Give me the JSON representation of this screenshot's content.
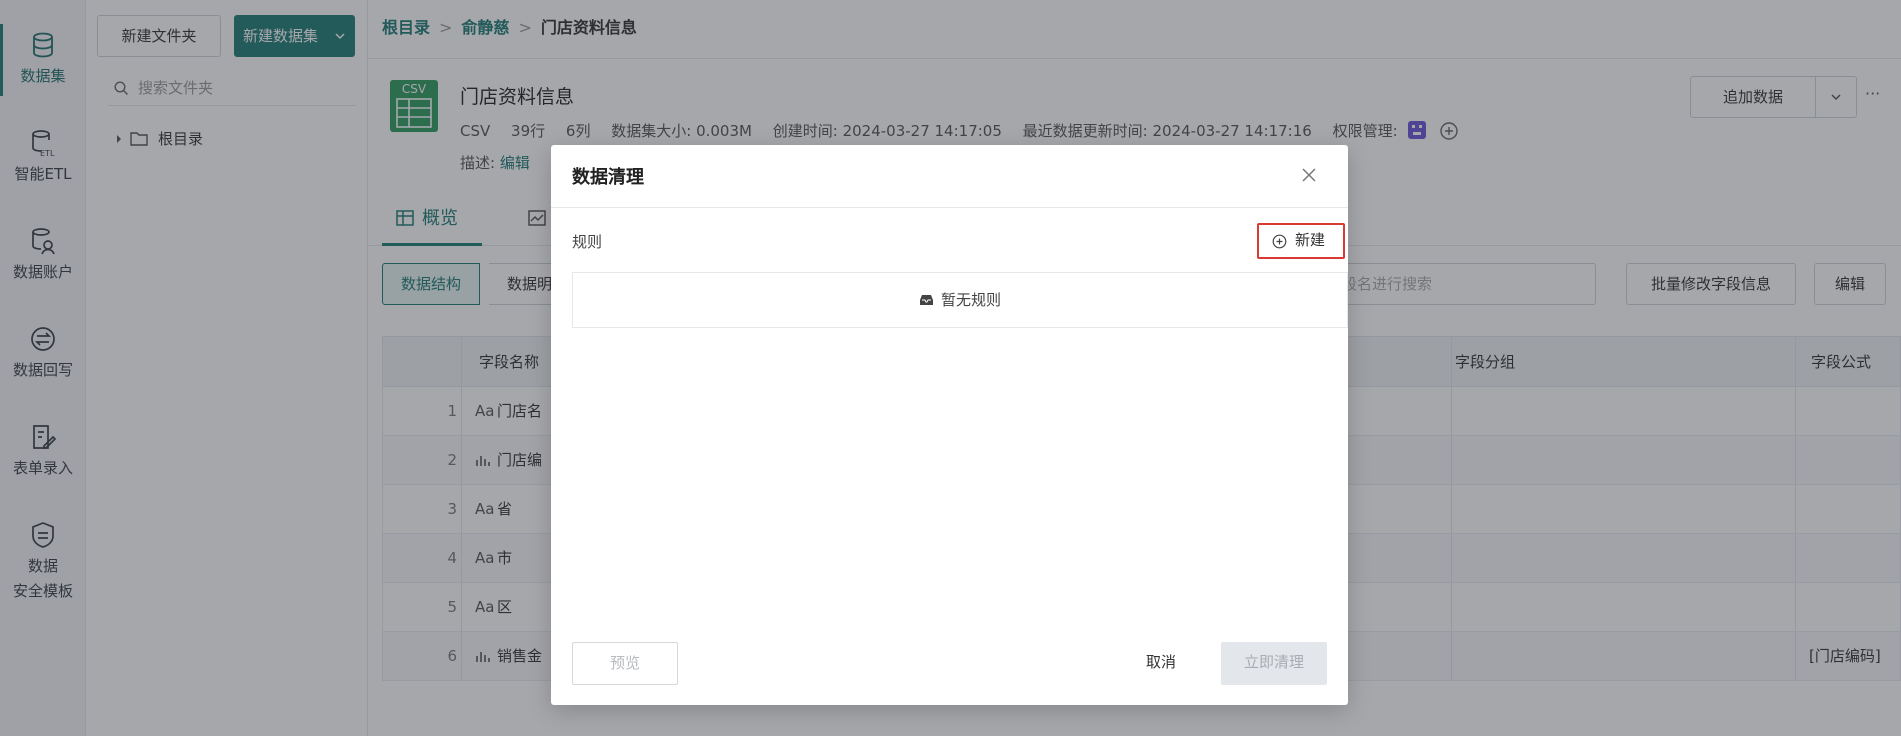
{
  "nav": {
    "items": [
      {
        "label": "数据集",
        "icon": "database-icon"
      },
      {
        "label": "智能ETL",
        "icon": "etl-icon"
      },
      {
        "label": "数据账户",
        "icon": "data-account-icon"
      },
      {
        "label": "数据回写",
        "icon": "writeback-icon"
      },
      {
        "label": "表单录入",
        "icon": "form-entry-icon"
      },
      {
        "label_line1": "数据",
        "label_line2": "安全模板",
        "icon": "shield-doc-icon"
      }
    ]
  },
  "folders": {
    "new_folder_label": "新建文件夹",
    "new_dataset_label": "新建数据集",
    "search_placeholder": "搜索文件夹",
    "tree_root": "根目录"
  },
  "breadcrumb": {
    "root": "根目录",
    "user": "俞静慈",
    "current": "门店资料信息",
    "separator": ">"
  },
  "dataset": {
    "badge": "CSV",
    "title": "门店资料信息",
    "type": "CSV",
    "rows": "39行",
    "cols": "6列",
    "size": "数据集大小: 0.003M",
    "created": "创建时间: 2024-03-27 14:17:05",
    "updated": "最近数据更新时间: 2024-03-27 14:17:16",
    "permission": "权限管理:",
    "desc_label": "描述:",
    "desc_link": "编辑",
    "append_label": "追加数据",
    "more_label": "···"
  },
  "tabs": {
    "overview": "概览"
  },
  "toolbar": {
    "structure": "数据结构",
    "detail": "数据明",
    "search_placeholder": "字段名进行搜索",
    "batch_edit": "批量修改字段信息",
    "edit": "编辑"
  },
  "table": {
    "headers": {
      "name": "字段名称",
      "group": "字段分组",
      "formula": "字段公式"
    },
    "rows": [
      {
        "index": "1",
        "prefix": "Aa",
        "name": "门店名",
        "formula": ""
      },
      {
        "index": "2",
        "prefix": "",
        "name": "门店编",
        "formula": ""
      },
      {
        "index": "3",
        "prefix": "Aa",
        "name": "省",
        "formula": ""
      },
      {
        "index": "4",
        "prefix": "Aa",
        "name": "市",
        "formula": ""
      },
      {
        "index": "5",
        "prefix": "Aa",
        "name": "区",
        "formula": ""
      },
      {
        "index": "6",
        "prefix": "",
        "name": "销售金",
        "formula": "[门店编码]"
      }
    ]
  },
  "modal": {
    "title": "数据清理",
    "rule_label": "规则",
    "new_label": "新建",
    "empty_text": "暂无规则",
    "preview_label": "预览",
    "cancel_label": "取消",
    "clean_label": "立即清理"
  },
  "colors": {
    "brand": "#1f7a74",
    "highlight": "#d93a33"
  }
}
